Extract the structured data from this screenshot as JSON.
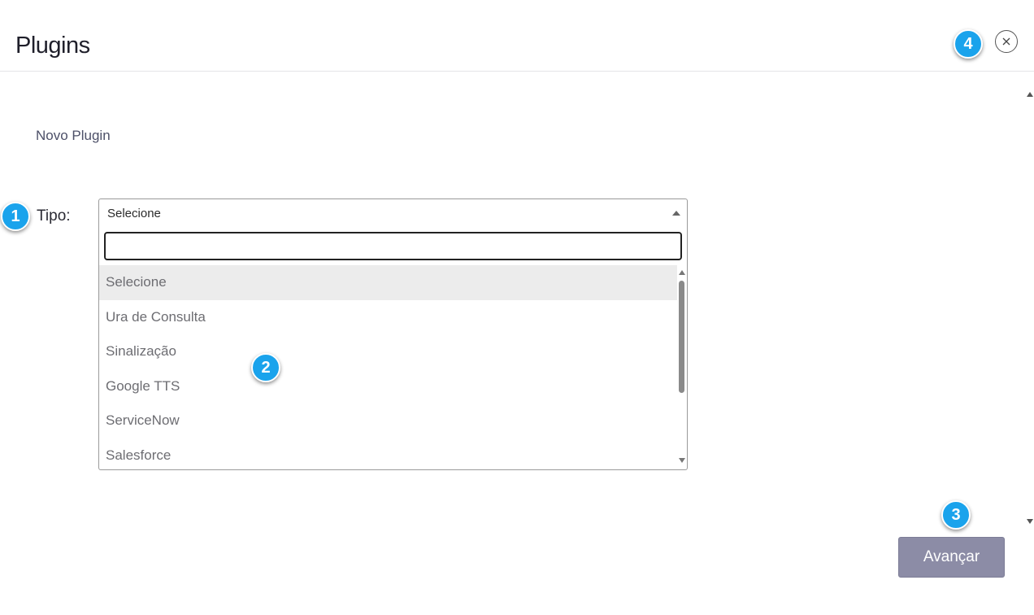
{
  "header": {
    "title": "Plugins",
    "close_icon": "close-icon"
  },
  "form": {
    "section_title": "Novo Plugin",
    "tipo_label": "Tipo:",
    "select": {
      "selected_value": "Selecione",
      "search_value": "",
      "options": [
        "Selecione",
        "Ura de Consulta",
        "Sinalização",
        "Google TTS",
        "ServiceNow",
        "Salesforce"
      ],
      "highlighted_index": 0
    }
  },
  "footer": {
    "next_label": "Avançar"
  },
  "badges": [
    "1",
    "2",
    "3",
    "4"
  ],
  "colors": {
    "badge": "#1aa3ec",
    "next_button": "#8c8ca6",
    "highlight": "#ececec"
  }
}
